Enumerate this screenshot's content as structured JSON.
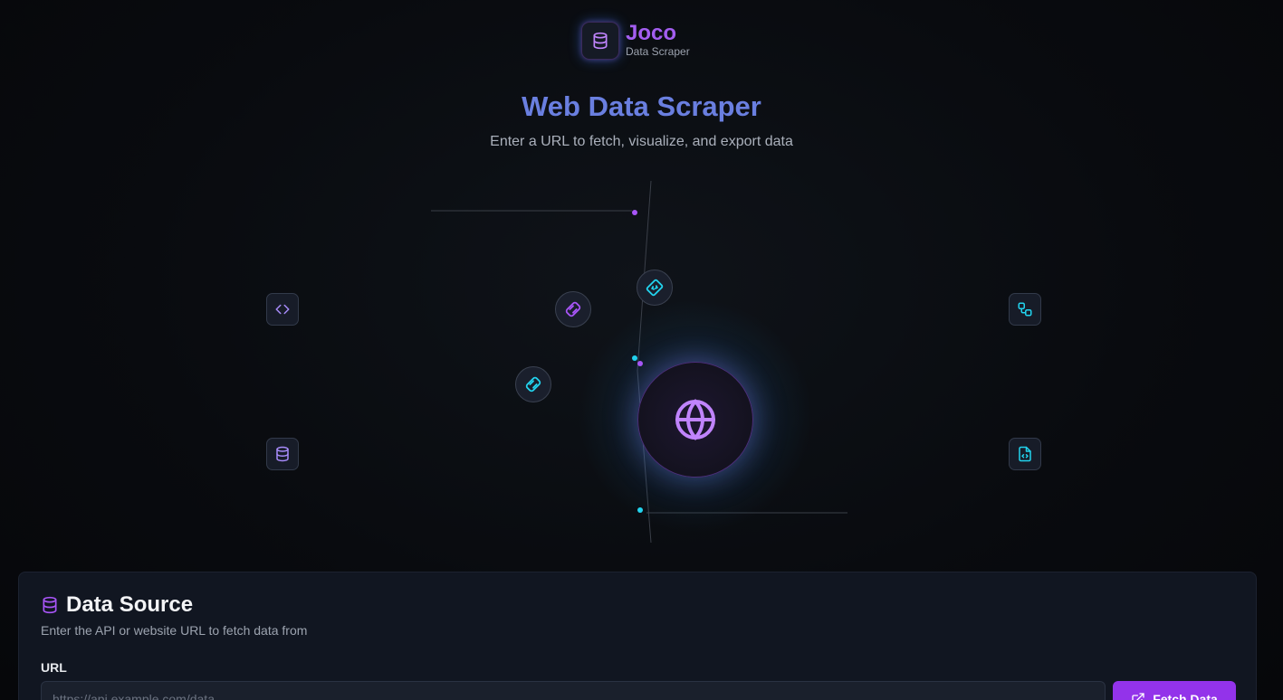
{
  "brand": {
    "name": "Joco",
    "subtitle": "Data Scraper"
  },
  "hero": {
    "title": "Web Data Scraper",
    "subtitle": "Enter a URL to fetch, visualize, and export data"
  },
  "colors": {
    "accent_purple": "#a855f7",
    "accent_cyan": "#22d3ee",
    "title_blue": "#6a7fe0",
    "button": "#9333ea"
  },
  "viz": {
    "hub_icon": "globe-icon",
    "nodes": [
      "code-icon",
      "database-icon",
      "workflow-icon",
      "file-code-icon"
    ],
    "orbit_icons": [
      "scroll-icon",
      "ticket-icon",
      "scroll-icon"
    ]
  },
  "data_source": {
    "title": "Data Source",
    "description": "Enter the API or website URL to fetch data from",
    "url_label": "URL",
    "url_placeholder": "https://api.example.com/data",
    "url_value": "",
    "fetch_label": "Fetch Data"
  }
}
